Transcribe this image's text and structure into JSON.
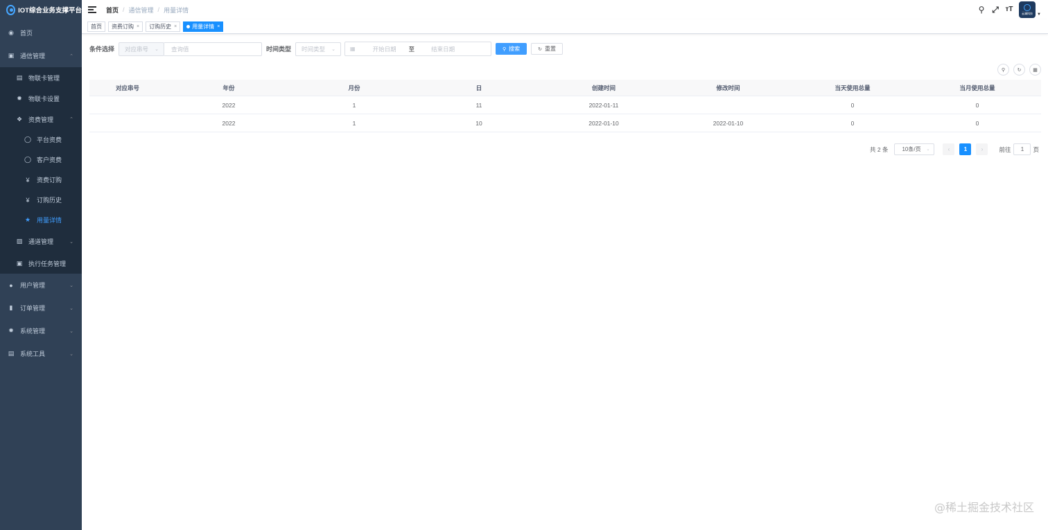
{
  "app": {
    "title": "IOT综合业务支撑平台"
  },
  "sidebar": {
    "items": [
      {
        "label": "首页",
        "icon": "dashboard-icon"
      },
      {
        "label": "通信管理",
        "icon": "message-icon"
      },
      {
        "label": "物联卡管理",
        "icon": "card-icon"
      },
      {
        "label": "物联卡设置",
        "icon": "gear-icon"
      },
      {
        "label": "资费管理",
        "icon": "tree-icon"
      },
      {
        "label": "平台资费",
        "icon": "shield-icon"
      },
      {
        "label": "客户资费",
        "icon": "shield-icon"
      },
      {
        "label": "资费订购",
        "icon": "yen-icon"
      },
      {
        "label": "订购历史",
        "icon": "yen-icon"
      },
      {
        "label": "用量详情",
        "icon": "star-icon"
      },
      {
        "label": "通道管理",
        "icon": "tree-icon"
      },
      {
        "label": "执行任务管理",
        "icon": "monitor-icon"
      },
      {
        "label": "用户管理",
        "icon": "user-icon"
      },
      {
        "label": "订单管理",
        "icon": "chart-icon"
      },
      {
        "label": "系统管理",
        "icon": "gear-icon"
      },
      {
        "label": "系统工具",
        "icon": "tool-icon"
      }
    ]
  },
  "breadcrumb": {
    "home": "首页",
    "sep": "/",
    "level1": "通信管理",
    "level2": "用量详情"
  },
  "avatar": {
    "text": "云澜科技"
  },
  "tags": [
    {
      "label": "首页"
    },
    {
      "label": "资费订购",
      "close": "×"
    },
    {
      "label": "订购历史",
      "close": "×"
    },
    {
      "label": "用量详情",
      "close": "×"
    }
  ],
  "search": {
    "condition_label": "条件选择",
    "condition_select": "对应串号",
    "query_placeholder": "查询值",
    "time_type_label": "时间类型",
    "time_type_select": "时间类型",
    "start_date": "开始日期",
    "to": "至",
    "end_date": "结束日期",
    "search_btn": "搜索",
    "reset_btn": "重置"
  },
  "table": {
    "headers": [
      "对应串号",
      "年份",
      "月份",
      "日",
      "创建时间",
      "修改时间",
      "当天使用总量",
      "当月使用总量"
    ],
    "rows": [
      [
        "",
        "2022",
        "1",
        "11",
        "2022-01-11",
        "",
        "0",
        "0"
      ],
      [
        "",
        "2022",
        "1",
        "10",
        "2022-01-10",
        "2022-01-10",
        "0",
        "0"
      ]
    ]
  },
  "pagination": {
    "total": "共 2 条",
    "page_size": "10条/页",
    "current": "1",
    "goto_label": "前往",
    "goto_value": "1",
    "page_unit": "页"
  },
  "watermark": "@稀土掘金技术社区"
}
